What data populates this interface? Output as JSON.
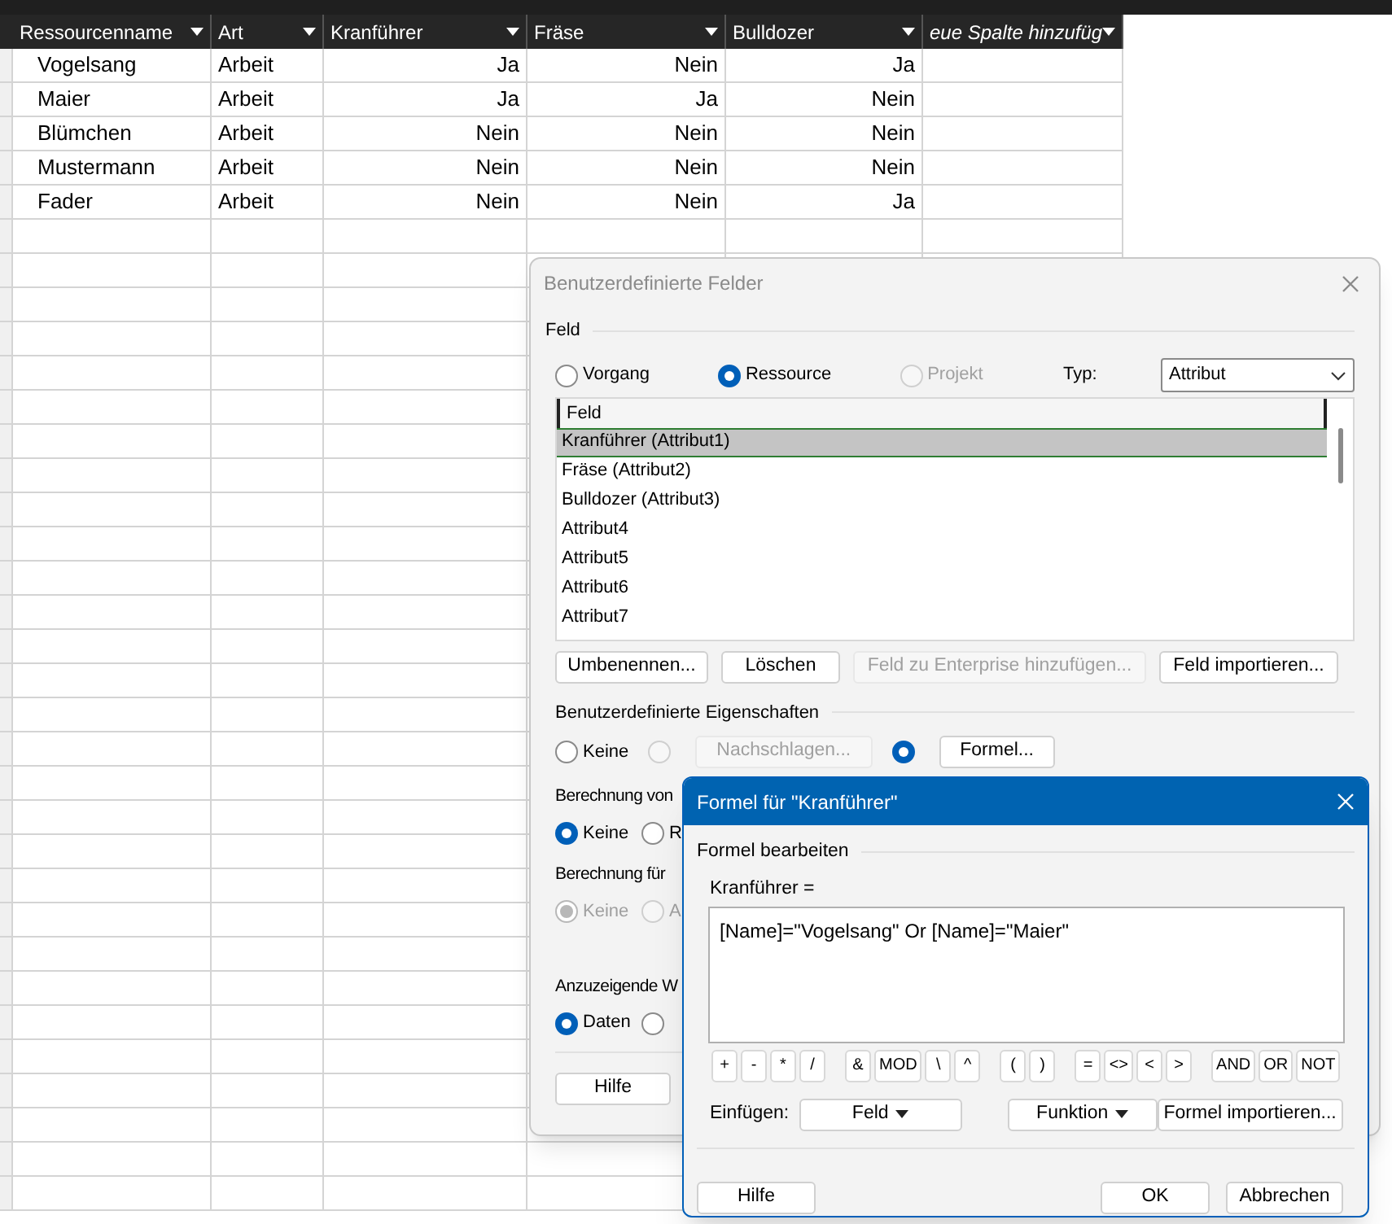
{
  "sheet": {
    "columns": [
      "Ressourcenname",
      "Art",
      "Kranführer",
      "Fräse",
      "Bulldozer",
      "eue Spalte hinzufüg"
    ],
    "rows": [
      {
        "cells": [
          "Vogelsang",
          "Arbeit",
          "Ja",
          "Nein",
          "Ja"
        ]
      },
      {
        "cells": [
          "Maier",
          "Arbeit",
          "Ja",
          "Ja",
          "Nein"
        ]
      },
      {
        "cells": [
          "Blümchen",
          "Arbeit",
          "Nein",
          "Nein",
          "Nein"
        ]
      },
      {
        "cells": [
          "Mustermann",
          "Arbeit",
          "Nein",
          "Nein",
          "Nein"
        ]
      },
      {
        "cells": [
          "Fader",
          "Arbeit",
          "Nein",
          "Nein",
          "Ja"
        ]
      }
    ]
  },
  "custom_fields_dialog": {
    "title": "Benutzerdefinierte Felder",
    "field_label": "Feld",
    "scope_options": [
      {
        "label": "Vorgang",
        "selected": false,
        "disabled": false
      },
      {
        "label": "Ressource",
        "selected": true,
        "disabled": false
      },
      {
        "label": "Projekt",
        "selected": false,
        "disabled": true
      }
    ],
    "type_label": "Typ:",
    "type_value": "Attribut",
    "list_header": "Feld",
    "fields": [
      {
        "label": "Kranführer (Attribut1)",
        "selected": true
      },
      {
        "label": "Fräse (Attribut2)",
        "selected": false
      },
      {
        "label": "Bulldozer (Attribut3)",
        "selected": false
      },
      {
        "label": "Attribut4",
        "selected": false
      },
      {
        "label": "Attribut5",
        "selected": false
      },
      {
        "label": "Attribut6",
        "selected": false
      },
      {
        "label": "Attribut7",
        "selected": false
      }
    ],
    "field_buttons": [
      {
        "label": "Umbenennen...",
        "disabled": false
      },
      {
        "label": "Löschen",
        "disabled": false
      },
      {
        "label": "Feld zu Enterprise hinzufügen...",
        "disabled": true
      },
      {
        "label": "Feld importieren...",
        "disabled": false
      }
    ],
    "properties_label": "Benutzerdefinierte Eigenschaften",
    "property_options": [
      {
        "label": "Keine",
        "selected": false,
        "disabled": false
      },
      {
        "button": "Nachschlagen...",
        "selected": false,
        "disabled": true
      },
      {
        "button": "Formel...",
        "selected": true,
        "disabled": false
      }
    ],
    "calc_label": "Berechnung von",
    "calc_options": [
      {
        "label": "Keine",
        "selected": true,
        "disabled": false
      },
      {
        "label": "R",
        "selected": false,
        "disabled": false
      }
    ],
    "summary_label": "Berechnung für",
    "summary_options": [
      {
        "label": "Keine",
        "selected": true,
        "disabled": true
      },
      {
        "label": "A",
        "selected": false,
        "disabled": true
      }
    ],
    "display_label": "Anzuzeigende W",
    "display_options": [
      {
        "label": "Daten",
        "selected": true,
        "disabled": false
      },
      {
        "selected": false,
        "disabled": false
      }
    ],
    "help_button": "Hilfe"
  },
  "formula_dialog": {
    "title": "Formel für \"Kranführer\"",
    "section_label": "Formel bearbeiten",
    "field_label": "Kranführer =",
    "formula": "[Name]=\"Vogelsang\" Or [Name]=\"Maier\"",
    "operator_groups": [
      [
        "+",
        "-",
        "*",
        "/"
      ],
      [
        "&",
        "MOD",
        "\\",
        "^"
      ],
      [
        "(",
        ")"
      ],
      [
        "=",
        "<>",
        "<",
        ">"
      ],
      [
        "AND",
        "OR",
        "NOT"
      ]
    ],
    "insert_label": "Einfügen:",
    "insert_buttons": [
      "Feld",
      "Funktion"
    ],
    "import_button": "Formel importieren...",
    "help_button": "Hilfe",
    "ok_button": "OK",
    "cancel_button": "Abbrechen"
  }
}
